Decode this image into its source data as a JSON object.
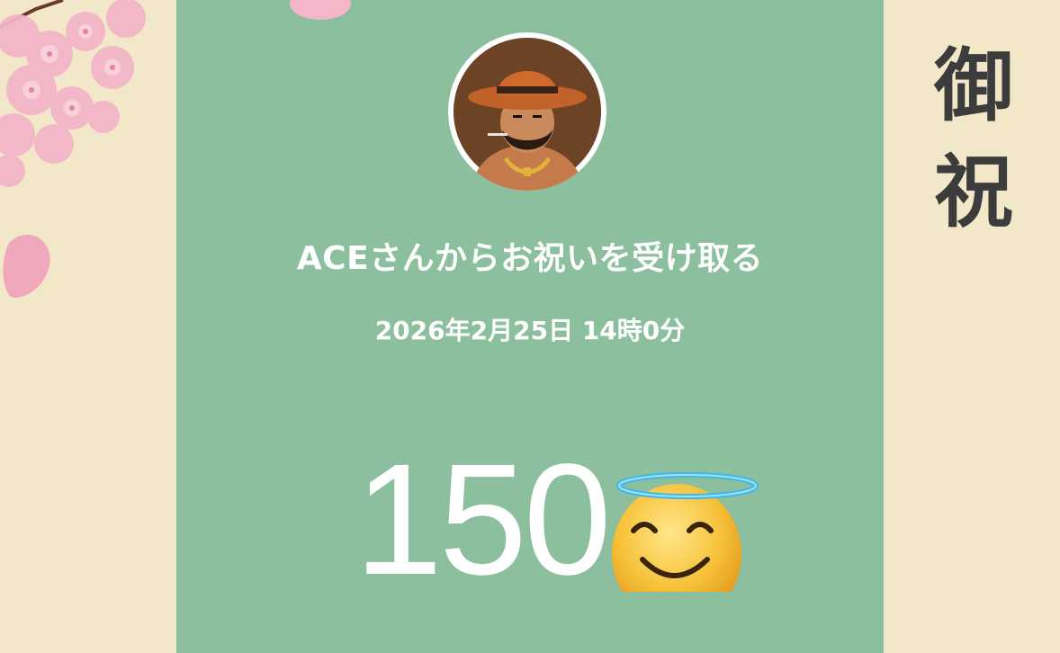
{
  "sender": {
    "name_line": "ACEさんからお祝いを受け取る",
    "avatar_icon": "avatar-cowboy-icon"
  },
  "gift": {
    "datetime": "2026年2月25日 14時0分",
    "amount": "150",
    "emoji_icon": "smiling-face-with-halo-icon"
  },
  "decoration": {
    "banner_char_1": "御",
    "banner_char_2": "祝",
    "left_ornament": "cherry-blossom-icon"
  },
  "colors": {
    "card_background": "#8cbf9d",
    "page_background": "#f2e7c8",
    "text": "#ffffff",
    "kanji": "#3c3c3c",
    "blossom": "#f4b6c8"
  }
}
